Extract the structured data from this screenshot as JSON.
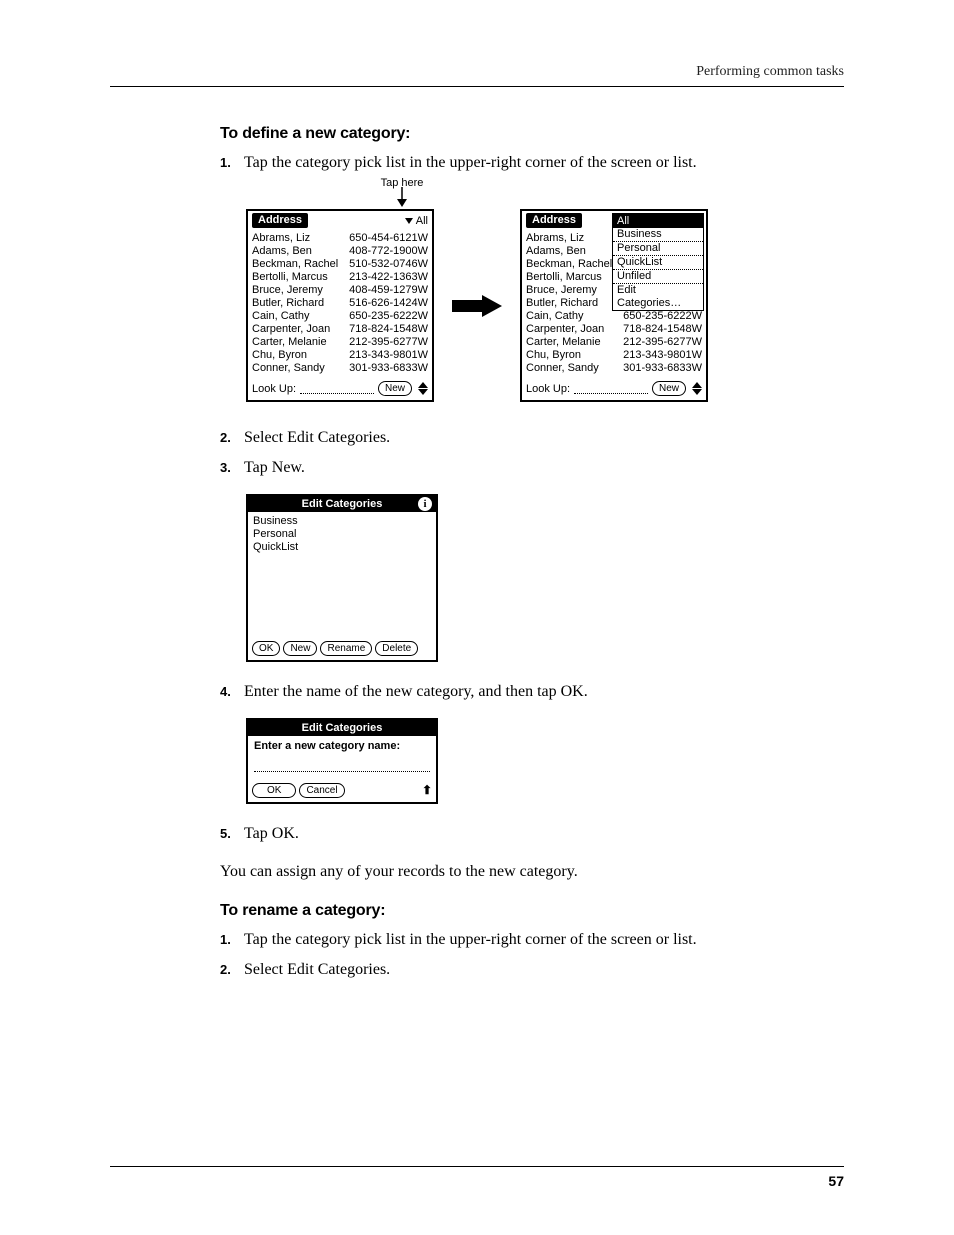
{
  "header": {
    "running_head": "Performing common tasks"
  },
  "section1": {
    "title": "To define a new category:",
    "steps": {
      "s1": "Tap the category pick list in the upper-right corner of the screen or list.",
      "s2": "Select Edit Categories.",
      "s3": "Tap New.",
      "s4": "Enter the name of the new category, and then tap OK.",
      "s5": "Tap OK."
    },
    "after": "You can assign any of your records to the new category."
  },
  "section2": {
    "title": "To rename a category:",
    "steps": {
      "s1": "Tap the category pick list in the upper-right corner of the screen or list.",
      "s2": "Select Edit Categories."
    }
  },
  "palm": {
    "tap_here": "Tap here",
    "address_title": "Address",
    "picklist_current": "All",
    "lookup_label": "Look Up:",
    "new_btn": "New",
    "contacts": [
      {
        "name": "Abrams, Liz",
        "phone": "650-454-6121W"
      },
      {
        "name": "Adams, Ben",
        "phone": "408-772-1900W"
      },
      {
        "name": "Beckman, Rachel",
        "phone": "510-532-0746W"
      },
      {
        "name": "Bertolli, Marcus",
        "phone": "213-422-1363W"
      },
      {
        "name": "Bruce, Jeremy",
        "phone": "408-459-1279W"
      },
      {
        "name": "Butler, Richard",
        "phone": "516-626-1424W"
      },
      {
        "name": "Cain, Cathy",
        "phone": "650-235-6222W"
      },
      {
        "name": "Carpenter, Joan",
        "phone": "718-824-1548W"
      },
      {
        "name": "Carter, Melanie",
        "phone": "212-395-6277W"
      },
      {
        "name": "Chu, Byron",
        "phone": "213-343-9801W"
      },
      {
        "name": "Conner, Sandy",
        "phone": "301-933-6833W"
      }
    ],
    "dropdown": {
      "header": "All",
      "items": [
        "Business",
        "Personal",
        "QuickList",
        "Unfiled",
        "Edit Categories…"
      ]
    }
  },
  "edit_cat": {
    "title": "Edit Categories",
    "items": [
      "Business",
      "Personal",
      "QuickList"
    ],
    "buttons": {
      "ok": "OK",
      "new": "New",
      "rename": "Rename",
      "delete": "Delete"
    }
  },
  "new_cat": {
    "title": "Edit Categories",
    "prompt": "Enter a new category name:",
    "buttons": {
      "ok": "OK",
      "cancel": "Cancel"
    }
  },
  "page_number": "57"
}
